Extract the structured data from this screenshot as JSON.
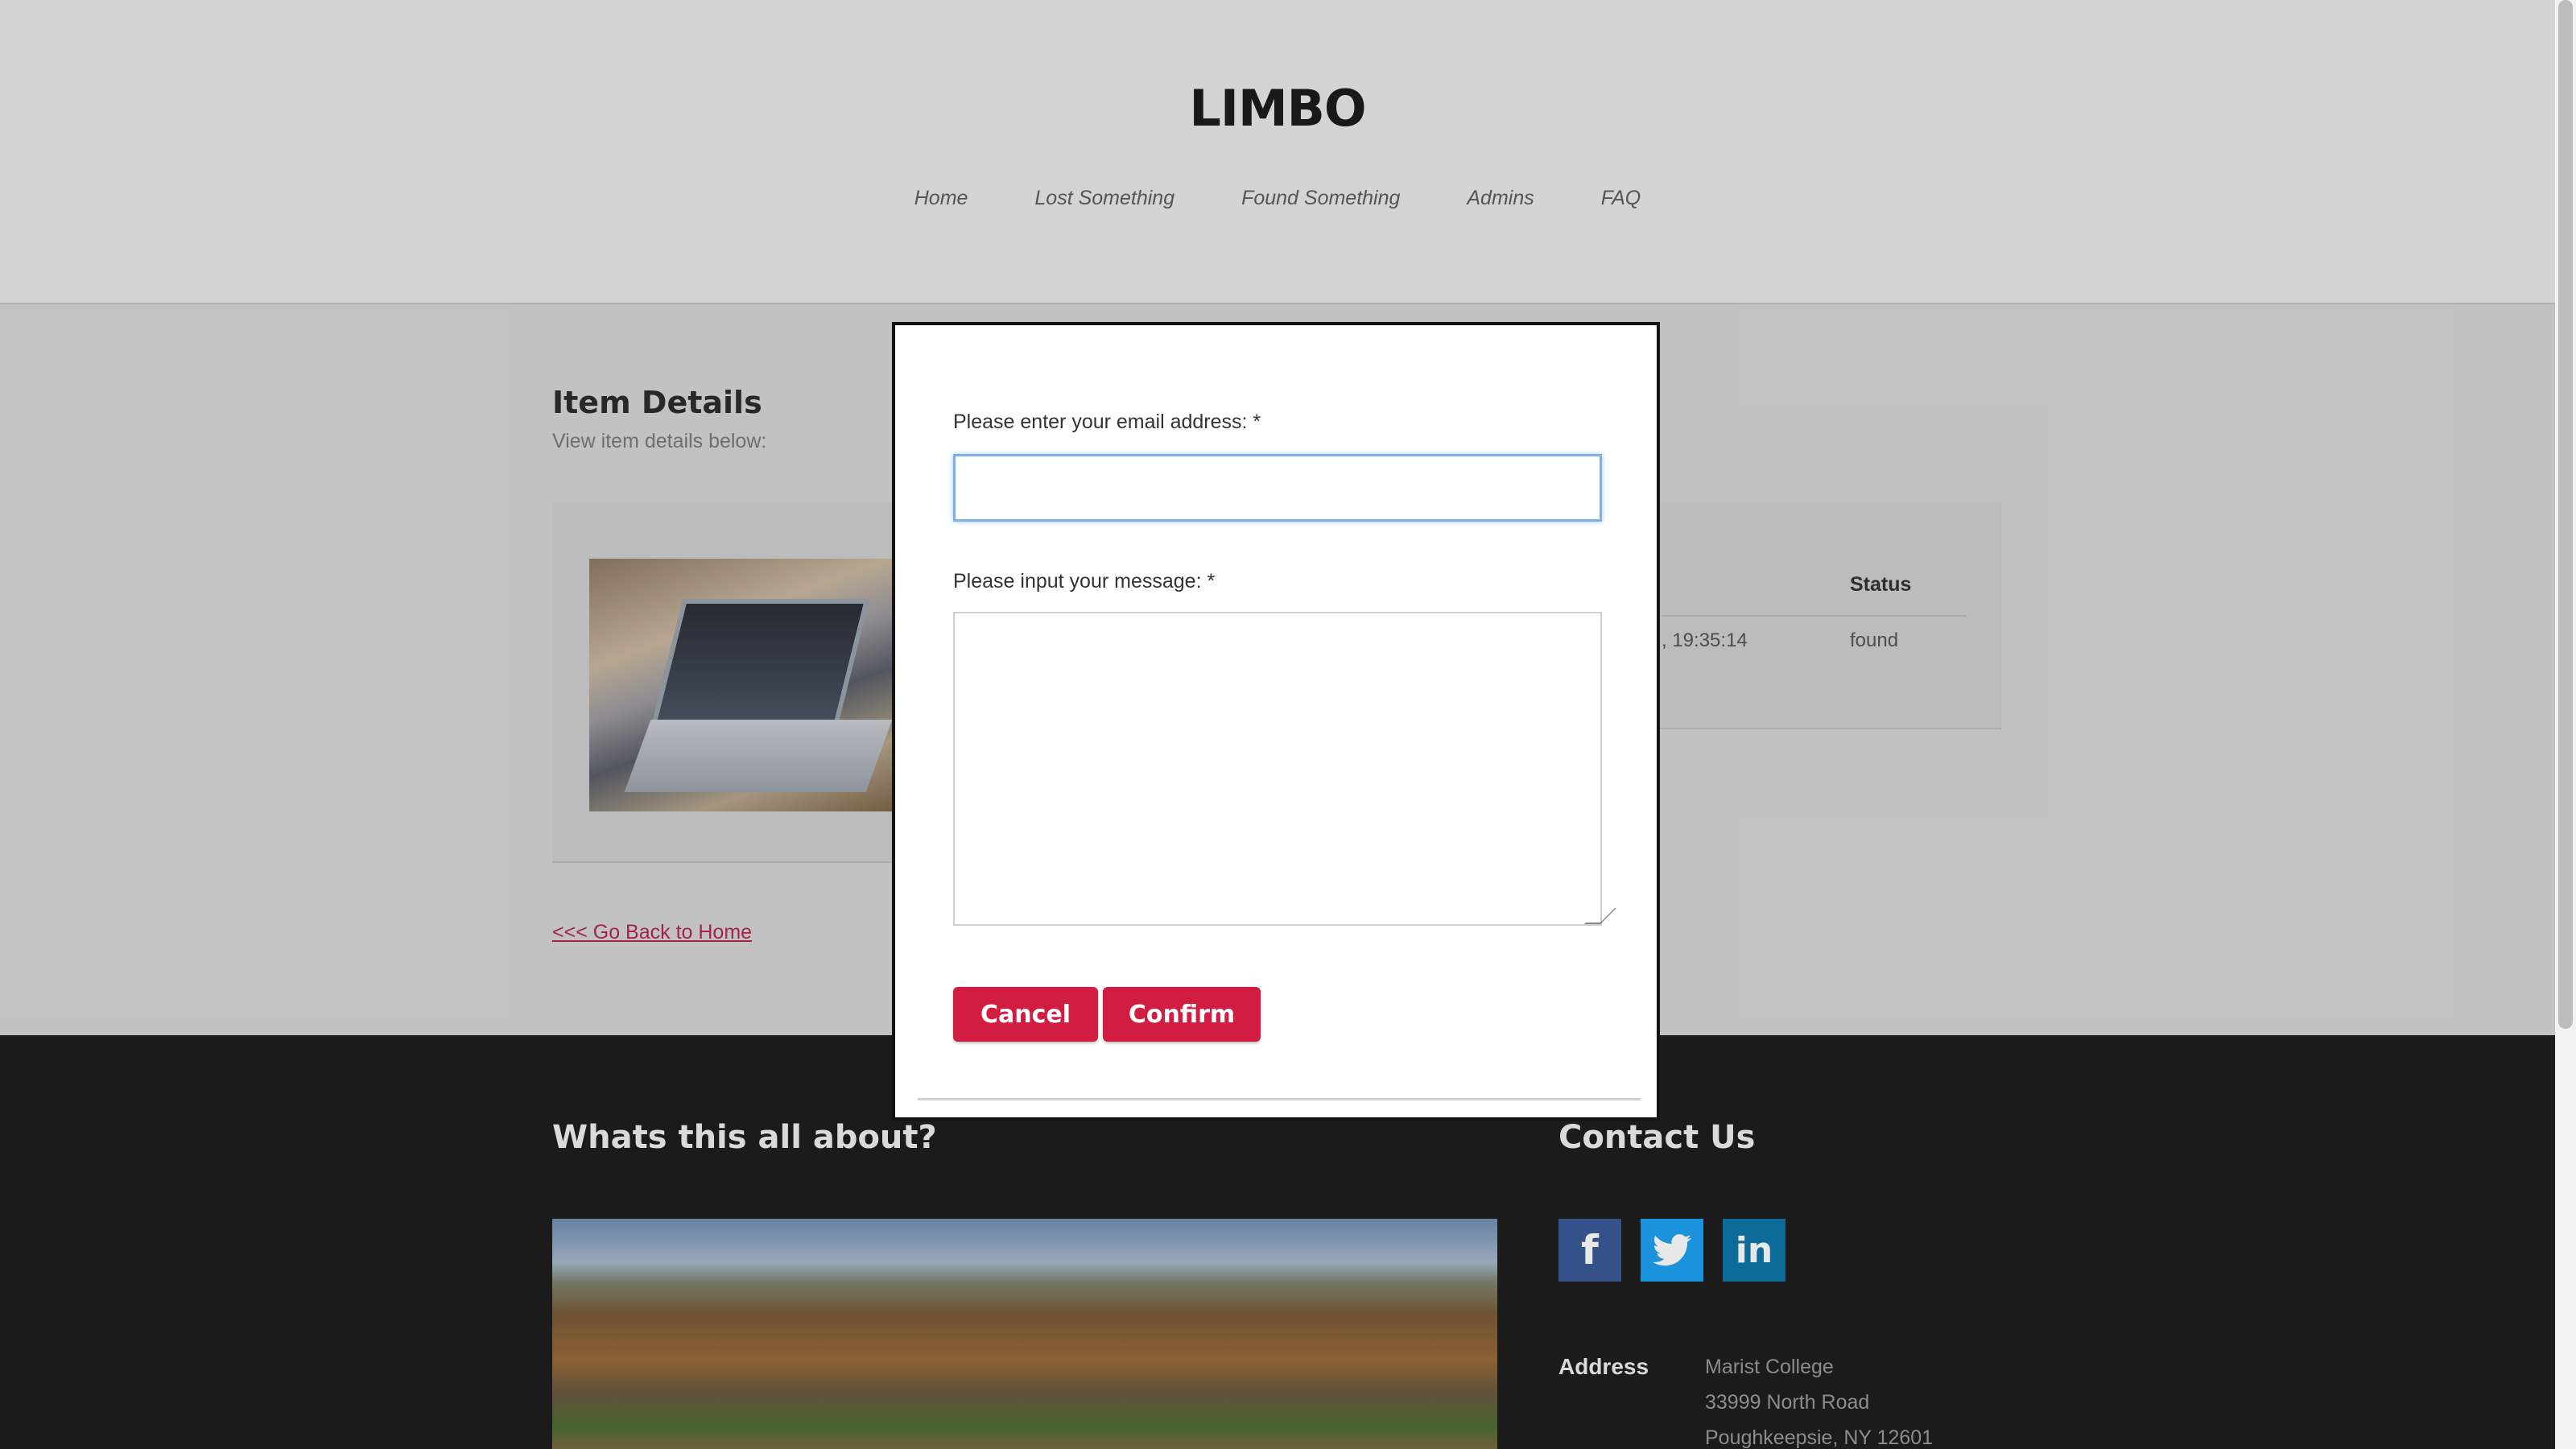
{
  "header": {
    "site_title": "LIMBO",
    "nav": [
      "Home",
      "Lost Something",
      "Found Something",
      "Admins",
      "FAQ"
    ]
  },
  "details": {
    "title": "Item Details",
    "subtitle": "View item details below:",
    "table": {
      "status_header": "Status",
      "time_fragment": ", 19:35:14",
      "status_value": "found"
    },
    "back_link": "<<< Go Back to Home"
  },
  "modal": {
    "email_label": "Please enter your email address: *",
    "email_value": "",
    "message_label": "Please input your message: *",
    "message_value": "",
    "cancel_label": "Cancel",
    "confirm_label": "Confirm",
    "button_color": "#d21d42"
  },
  "footer": {
    "about_title": "Whats this all about?",
    "contact_title": "Contact Us",
    "social": {
      "facebook_glyph": "f",
      "twitter_glyph": "t",
      "linkedin_glyph": "in"
    },
    "address_label": "Address",
    "address_lines": [
      "Marist College",
      "33999 North Road",
      "Poughkeepsie, NY 12601"
    ]
  }
}
